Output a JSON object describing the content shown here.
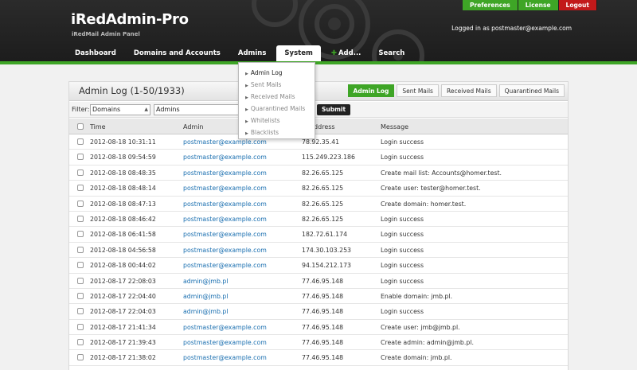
{
  "header": {
    "brand_title": "iRedAdmin-Pro",
    "brand_sub": "iRedMail Admin Panel",
    "top_buttons": [
      "Preferences",
      "License",
      "Logout"
    ],
    "logged_in": "Logged in as postmaster@example.com",
    "nav": [
      "Dashboard",
      "Domains and Accounts",
      "Admins",
      "System",
      "Add...",
      "Search"
    ],
    "accent_green": "#3ea526",
    "logout_red": "#c2191a"
  },
  "panel": {
    "title": "Admin Log (1-50/1933)",
    "tabs": [
      "Admin Log",
      "Sent Mails",
      "Received Mails",
      "Quarantined Mails"
    ],
    "filter_label": "Filter:",
    "filter_select_1": "Domains",
    "filter_select_2": "Admins",
    "submit": "Submit"
  },
  "dropdown": {
    "items": [
      "Admin Log",
      "Sent Mails",
      "Received Mails",
      "Quarantined Mails",
      "Whitelists",
      "Blacklists"
    ]
  },
  "table": {
    "headers": [
      "Time",
      "Admin",
      "IP Address",
      "Message"
    ],
    "rows": [
      {
        "time": "2012-08-18 10:31:11",
        "admin": "postmaster@example.com",
        "ip": "78.92.35.41",
        "msg": "Login success"
      },
      {
        "time": "2012-08-18 09:54:59",
        "admin": "postmaster@example.com",
        "ip": "115.249.223.186",
        "msg": "Login success"
      },
      {
        "time": "2012-08-18 08:48:35",
        "admin": "postmaster@example.com",
        "ip": "82.26.65.125",
        "msg": "Create mail list: Accounts@homer.test."
      },
      {
        "time": "2012-08-18 08:48:14",
        "admin": "postmaster@example.com",
        "ip": "82.26.65.125",
        "msg": "Create user: tester@homer.test."
      },
      {
        "time": "2012-08-18 08:47:13",
        "admin": "postmaster@example.com",
        "ip": "82.26.65.125",
        "msg": "Create domain: homer.test."
      },
      {
        "time": "2012-08-18 08:46:42",
        "admin": "postmaster@example.com",
        "ip": "82.26.65.125",
        "msg": "Login success"
      },
      {
        "time": "2012-08-18 06:41:58",
        "admin": "postmaster@example.com",
        "ip": "182.72.61.174",
        "msg": "Login success"
      },
      {
        "time": "2012-08-18 04:56:58",
        "admin": "postmaster@example.com",
        "ip": "174.30.103.253",
        "msg": "Login success"
      },
      {
        "time": "2012-08-18 00:44:02",
        "admin": "postmaster@example.com",
        "ip": "94.154.212.173",
        "msg": "Login success"
      },
      {
        "time": "2012-08-17 22:08:03",
        "admin": "admin@jmb.pl",
        "ip": "77.46.95.148",
        "msg": "Login success"
      },
      {
        "time": "2012-08-17 22:04:40",
        "admin": "admin@jmb.pl",
        "ip": "77.46.95.148",
        "msg": "Enable domain: jmb.pl."
      },
      {
        "time": "2012-08-17 22:04:03",
        "admin": "admin@jmb.pl",
        "ip": "77.46.95.148",
        "msg": "Login success"
      },
      {
        "time": "2012-08-17 21:41:34",
        "admin": "postmaster@example.com",
        "ip": "77.46.95.148",
        "msg": "Create user: jmb@jmb.pl."
      },
      {
        "time": "2012-08-17 21:39:43",
        "admin": "postmaster@example.com",
        "ip": "77.46.95.148",
        "msg": "Create admin: admin@jmb.pl."
      },
      {
        "time": "2012-08-17 21:38:02",
        "admin": "postmaster@example.com",
        "ip": "77.46.95.148",
        "msg": "Create domain: jmb.pl."
      }
    ]
  }
}
